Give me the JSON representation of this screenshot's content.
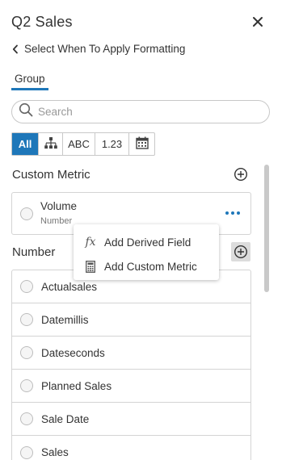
{
  "panel": {
    "title": "Q2 Sales"
  },
  "back": {
    "label": "Select When To Apply Formatting"
  },
  "tabs": [
    {
      "label": "Group"
    }
  ],
  "search": {
    "placeholder": "Search",
    "value": ""
  },
  "filters": [
    {
      "label": "All",
      "active": true
    },
    {
      "icon": "hierarchy-icon"
    },
    {
      "label": "ABC"
    },
    {
      "label": "1.23"
    },
    {
      "icon": "calendar-icon"
    }
  ],
  "custom_metric": {
    "title": "Custom Metric",
    "items": [
      {
        "name": "Volume",
        "type": "Number"
      }
    ]
  },
  "number": {
    "title": "Number",
    "items": [
      {
        "label": "Actualsales"
      },
      {
        "label": "Datemillis"
      },
      {
        "label": "Dateseconds"
      },
      {
        "label": "Planned Sales"
      },
      {
        "label": "Sale Date"
      },
      {
        "label": "Sales"
      }
    ]
  },
  "popup": {
    "items": [
      {
        "icon": "fx-icon",
        "glyph": "fx",
        "label": "Add Derived Field"
      },
      {
        "icon": "calculator-icon",
        "label": "Add Custom Metric"
      }
    ]
  },
  "colors": {
    "accent": "#1e77b9",
    "border": "#d4d4d4",
    "text": "#333333"
  }
}
